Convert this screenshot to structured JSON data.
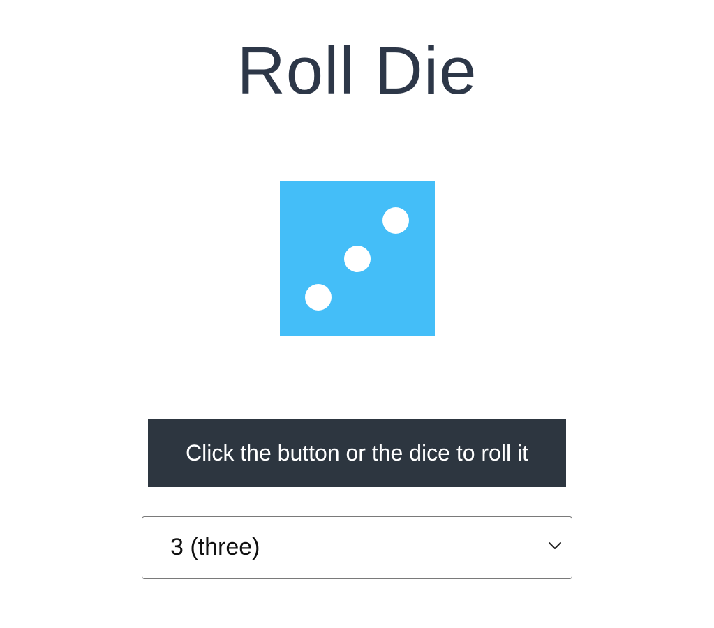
{
  "page": {
    "title": "Roll Die"
  },
  "die": {
    "face_value": 3,
    "color": "#44bef8",
    "pip_color": "#ffffff"
  },
  "roll_button": {
    "label": "Click the button or the dice to roll it",
    "background": "#2d3640",
    "text_color": "#ffffff"
  },
  "face_select": {
    "selected": "3 (three)",
    "icon": "chevron-down-icon"
  },
  "colors": {
    "title": "#2d3748",
    "page_background": "#ffffff"
  }
}
